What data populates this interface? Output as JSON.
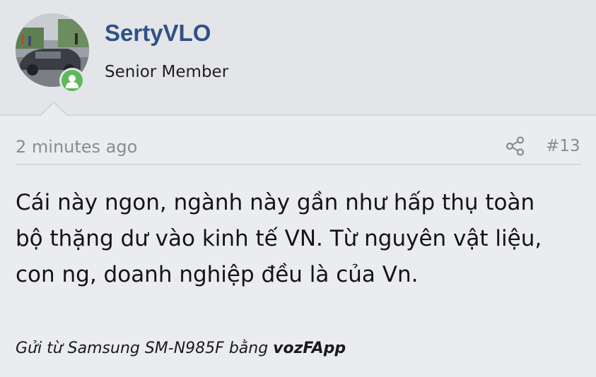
{
  "post": {
    "author": {
      "username": "SertyVLO",
      "title": "Senior Member",
      "avatar_icon": "avatar-photo",
      "online_icon": "user-online-icon"
    },
    "meta": {
      "timestamp": "2 minutes ago",
      "post_number": "#13",
      "share_icon": "share-icon"
    },
    "body_lines": [
      "Cái này ngon, ngành này gần như hấp thụ toàn",
      "bộ thặng dư vào kinh tế VN. Từ nguyên vật liệu,",
      "con ng, doanh nghiệp đều là của Vn."
    ],
    "signature": {
      "prefix": "Gửi từ Samsung SM-N985F bằng ",
      "app": "vozFApp"
    }
  },
  "colors": {
    "username": "#2f5187",
    "header_bg": "#e4e5e8",
    "body_bg": "#ebecef",
    "online": "#5fb85a",
    "muted": "#8a8c91"
  }
}
